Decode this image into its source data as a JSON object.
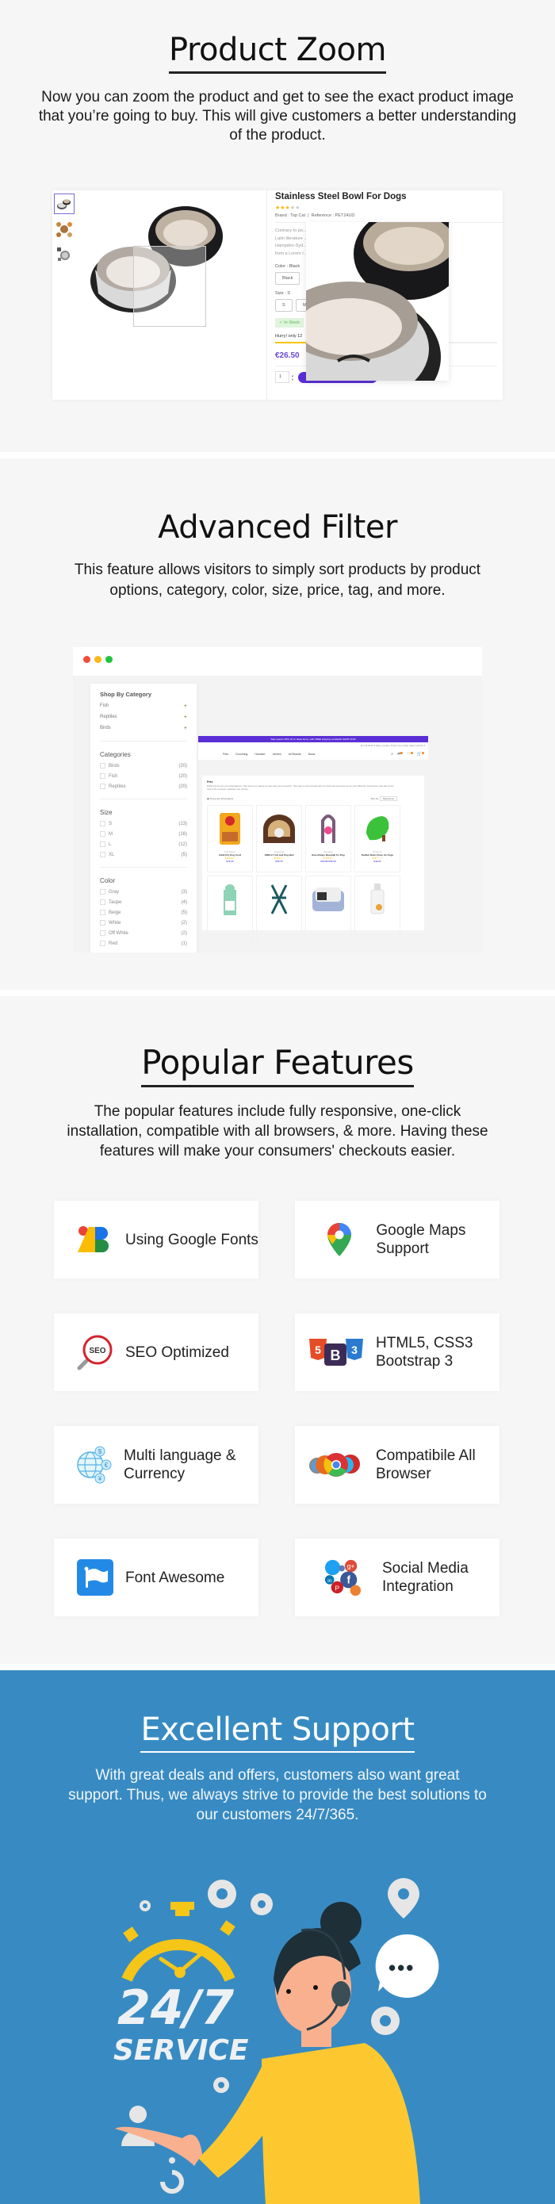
{
  "product_zoom": {
    "title": "Product Zoom",
    "description": "Now you can zoom the product and get to see the exact product image that you’re going to buy. This will give customers a better understanding of the product.",
    "product": {
      "name": "Stainless Steel Bowl For Dogs",
      "rating": 3,
      "rating_max": 5,
      "brand_label": "Brand : Top Cat",
      "reference_label": "Reference : PET24UD",
      "desc_lines": [
        "Contrary to po...  ...in a piece of classical",
        "Latin literature  ...a Latin professor at",
        "Hampden-Syd...  ...words, consectetur,",
        "from a Lorem I..."
      ],
      "color_label": "Color : Black",
      "color_option": "Black",
      "size_label": "Size : S",
      "size_options": [
        "S",
        "M"
      ],
      "stock": "✓ In Stock",
      "hurry": "Hurry! only 12",
      "stock_fraction": 0.4,
      "price": "€26.50",
      "quantity": "1",
      "add_to_cart": "Add To Cart"
    }
  },
  "advanced_filter": {
    "title": "Advanced Filter",
    "description": "This feature allows visitors to simply sort products by product options, category, color, size, price, tag, and more.",
    "window_dots": [
      "#f04e3a",
      "#f8b81c",
      "#20c33f"
    ],
    "filter": {
      "shop_by_category": "Shop By Category",
      "shop_categories": [
        "Fish",
        "Reptiles",
        "Birds"
      ],
      "categories_title": "Categories",
      "categories": [
        {
          "label": "Birds",
          "count": "(20)"
        },
        {
          "label": "Fish",
          "count": "(20)"
        },
        {
          "label": "Reptiles",
          "count": "(20)"
        }
      ],
      "size_title": "Size",
      "sizes": [
        {
          "label": "S",
          "count": "(13)"
        },
        {
          "label": "M",
          "count": "(16)"
        },
        {
          "label": "L",
          "count": "(12)"
        },
        {
          "label": "XL",
          "count": "(5)"
        }
      ],
      "color_title": "Color",
      "colors": [
        {
          "label": "Gray",
          "count": "(3)"
        },
        {
          "label": "Taupe",
          "count": "(4)"
        },
        {
          "label": "Beige",
          "count": "(5)"
        },
        {
          "label": "White",
          "count": "(2)"
        },
        {
          "label": "Off White",
          "count": "(2)"
        },
        {
          "label": "Red",
          "count": "(1)"
        }
      ]
    },
    "shop": {
      "promo": "Sale season 50% off on latest items, with FREE shipping worldwide  SHOP NOW",
      "topbar": "En ▾   € EUR ▾   Store Locator   Track Your Order   Admin Admin ▾",
      "nav": [
        "Pets",
        "Grooming",
        "Hamster",
        "Jerkies",
        "All Brands",
        "News"
      ],
      "category_title": "Pets",
      "category_desc": "Mobile phones are very advantageous. They help us in making our lives easy and convenient. They help us communicate with our loved ones and carry out our work efficiently. Furthermore, they also do the work of the computer, calculator, and camera.",
      "count_text": "There are 20 products",
      "sort_label": "Sort by:",
      "sort_value": "Relevance",
      "products": [
        {
          "brand": "Only Pattern",
          "name": "Adult Dry Dog Food",
          "stars": "★★★★☆",
          "price": "€73.44"
        },
        {
          "brand": "Pet Empire",
          "name": "GRELLY Cat and Dog Bed",
          "stars": "★★★☆☆",
          "price": "€50.70"
        },
        {
          "brand": "Pet Sense",
          "name": "Boosthings Baseball for Dog",
          "stars": "★★★★☆",
          "price": "€52.83 €63.59"
        },
        {
          "brand": "Pet Sense",
          "name": "Rubber Bath Glove for Dogs",
          "stars": "★★☆☆☆",
          "price": "€42.27"
        },
        {
          "brand": "",
          "name": "",
          "stars": "",
          "price": ""
        },
        {
          "brand": "",
          "name": "",
          "stars": "",
          "price": ""
        },
        {
          "brand": "",
          "name": "",
          "stars": "",
          "price": ""
        },
        {
          "brand": "",
          "name": "",
          "stars": "",
          "price": ""
        }
      ]
    }
  },
  "popular_features": {
    "title": "Popular Features",
    "description": "The popular features include  fully responsive, one-click installation, compatible with all browsers, & more. Having these features will make your consumers' checkouts easier.",
    "items": [
      {
        "label": "Using Google Fonts",
        "icon": "google-fonts-icon"
      },
      {
        "label": "Google Maps Support",
        "icon": "google-maps-icon"
      },
      {
        "label": "SEO Optimized",
        "icon": "seo-icon"
      },
      {
        "label": "HTML5, CSS3 Bootstrap 3",
        "icon": "html5-css3-bootstrap-icon"
      },
      {
        "label": "Multi language & Currency",
        "icon": "globe-currency-icon"
      },
      {
        "label": "Compatibile All Browser",
        "icon": "browsers-icon"
      },
      {
        "label": "Font Awesome",
        "icon": "font-awesome-flag-icon"
      },
      {
        "label": "Social Media Integration",
        "icon": "social-media-icon"
      }
    ]
  },
  "excellent_support": {
    "title": "Excellent Support",
    "description": "With great deals and offers, customers also want great support. Thus, we always strive to provide the best solutions to our customers 24/7/365.",
    "illustration": {
      "line1": "24/7",
      "line2": "SERVICE",
      "chat": "•••"
    },
    "bg_color": "#388bc2"
  }
}
